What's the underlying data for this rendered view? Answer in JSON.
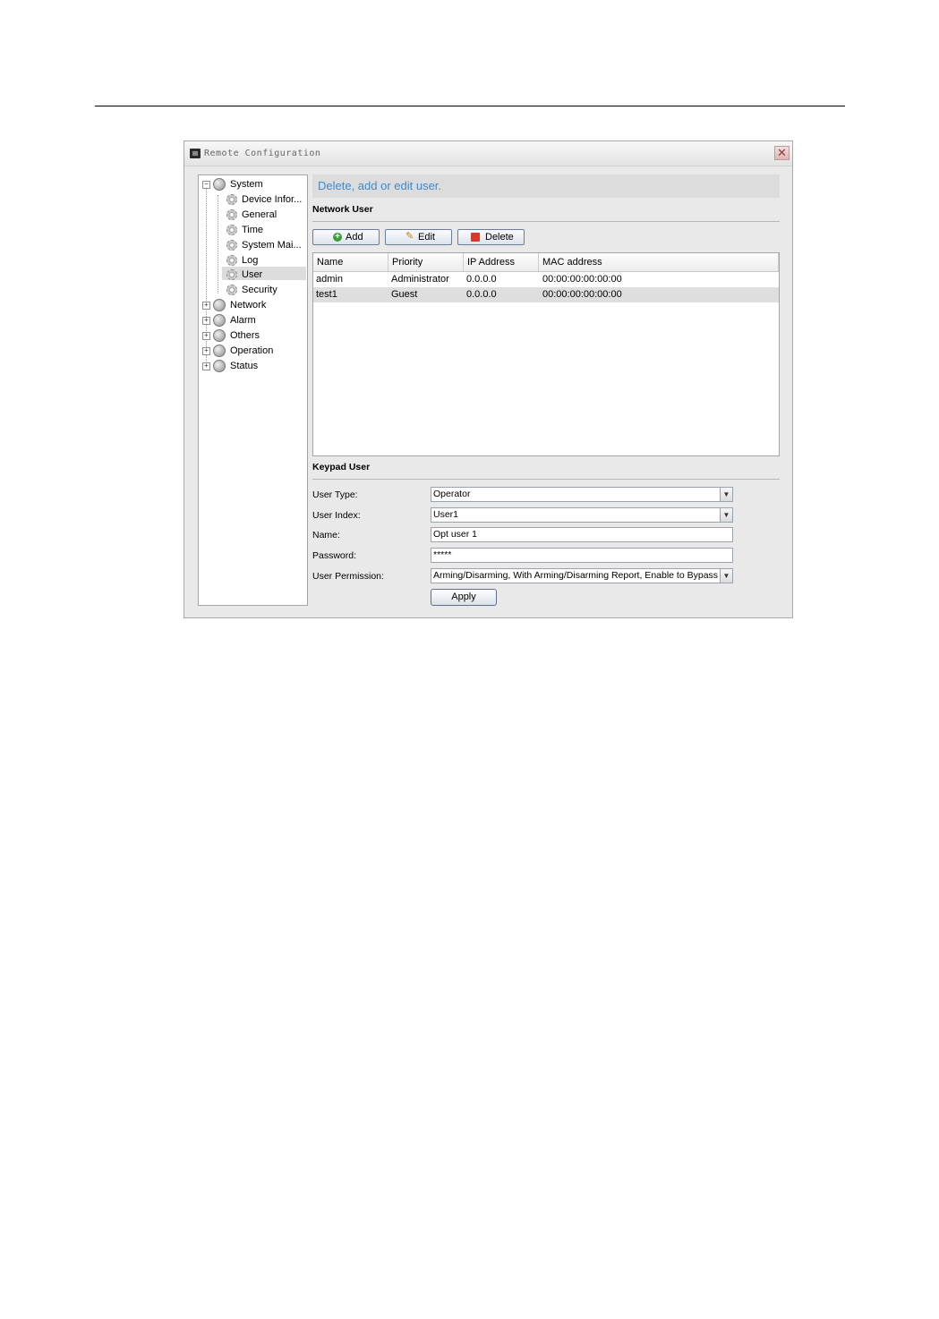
{
  "window": {
    "title": "Remote Configuration",
    "close_glyph": "✕"
  },
  "tree": {
    "root": [
      {
        "label": "System",
        "expanded": true,
        "children": [
          {
            "label": "Device Infor..."
          },
          {
            "label": "General"
          },
          {
            "label": "Time"
          },
          {
            "label": "System Mai..."
          },
          {
            "label": "Log"
          },
          {
            "label": "User",
            "selected": true
          },
          {
            "label": "Security"
          }
        ]
      },
      {
        "label": "Network"
      },
      {
        "label": "Alarm"
      },
      {
        "label": "Others"
      },
      {
        "label": "Operation"
      },
      {
        "label": "Status"
      }
    ]
  },
  "main": {
    "header": "Delete, add or edit user.",
    "network_user": {
      "title": "Network User",
      "buttons": {
        "add": "Add",
        "edit": "Edit",
        "delete": "Delete"
      },
      "columns": [
        "Name",
        "Priority",
        "IP Address",
        "MAC address"
      ],
      "rows": [
        [
          "admin",
          "Administrator",
          "0.0.0.0",
          "00:00:00:00:00:00"
        ],
        [
          "test1",
          "Guest",
          "0.0.0.0",
          "00:00:00:00:00:00"
        ]
      ]
    },
    "keypad_user": {
      "title": "Keypad User",
      "user_type_label": "User Type:",
      "user_type_value": "Operator",
      "user_index_label": "User Index:",
      "user_index_value": "User1",
      "name_label": "Name:",
      "name_value": "Opt user 1",
      "password_label": "Password:",
      "password_value": "*****",
      "permission_label": "User Permission:",
      "permission_value": "Arming/Disarming, With Arming/Disarming Report, Enable to Bypass",
      "apply": "Apply"
    }
  },
  "colors": {
    "header_text": "#3b8ad0",
    "selection": "#dcdcdc"
  },
  "icons": {
    "app": "app-icon",
    "folder": "globe-icon",
    "leaf": "gear-icon",
    "add": "add-icon",
    "edit": "edit-icon",
    "delete": "delete-icon",
    "dropdown": "chevron-down-icon"
  }
}
